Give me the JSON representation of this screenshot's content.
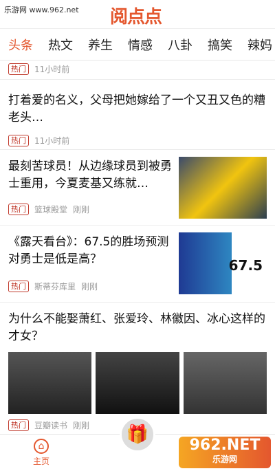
{
  "watermark": "乐游网 www.962.net",
  "app_logo": "阅点点",
  "tabs": [
    "头条",
    "热文",
    "养生",
    "情感",
    "八卦",
    "搞笑",
    "辣妈"
  ],
  "articles": [
    {
      "title": "",
      "tag": "热门",
      "source": "",
      "time": "11小时前"
    },
    {
      "title": "打着爱的名义，父母把她嫁给了一个又丑又色的糟老头…",
      "tag": "热门",
      "source": "",
      "time": "11小时前"
    },
    {
      "title": "最刻苦球员！从边缘球员到被勇士重用，今夏麦基又练就…",
      "tag": "热门",
      "source": "篮球殿堂",
      "time": "刚刚"
    },
    {
      "title": "《露天看台》：67.5的胜场预测对勇士是低是高？",
      "tag": "热门",
      "source": "斯蒂芬库里",
      "time": "刚刚",
      "thumb_text": "67.5"
    },
    {
      "title": "为什么不能娶萧红、张爱玲、林徽因、冰心这样的才女？",
      "tag": "热门",
      "source": "豆瓣读书",
      "time": "刚刚"
    }
  ],
  "bottom_nav": {
    "home_label": "主页"
  },
  "site_logo": {
    "main": "962.NET",
    "sub": "乐游网"
  }
}
